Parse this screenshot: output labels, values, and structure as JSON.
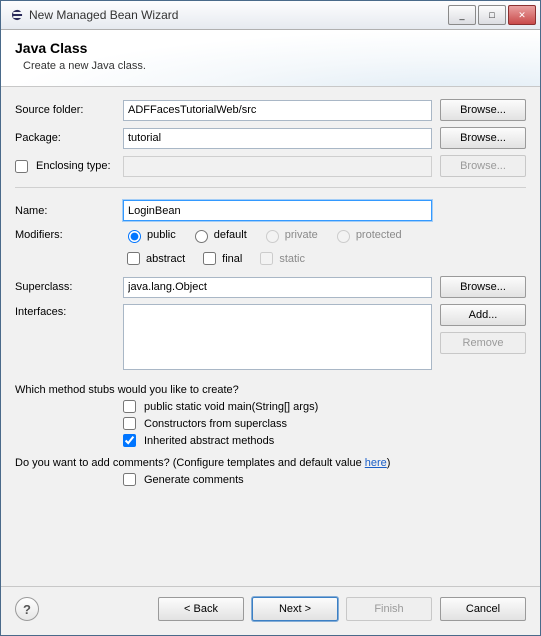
{
  "window": {
    "title": "New Managed Bean Wizard",
    "controls": {
      "minimize": "_",
      "maximize": "□",
      "close": "✕"
    }
  },
  "banner": {
    "heading": "Java Class",
    "subtext": "Create a new Java class."
  },
  "fields": {
    "sourceFolder": {
      "label": "Source folder:",
      "value": "ADFFacesTutorialWeb/src",
      "browse": "Browse..."
    },
    "package": {
      "label": "Package:",
      "value": "tutorial",
      "browse": "Browse..."
    },
    "enclosingType": {
      "label": "Enclosing type:",
      "value": "",
      "browse": "Browse..."
    },
    "name": {
      "label": "Name:",
      "value": "LoginBean"
    },
    "modifiers": {
      "label": "Modifiers:",
      "radios": {
        "public": "public",
        "default": "default",
        "private": "private",
        "protected": "protected"
      },
      "checks": {
        "abstract": "abstract",
        "final": "final",
        "static": "static"
      }
    },
    "superclass": {
      "label": "Superclass:",
      "value": "java.lang.Object",
      "browse": "Browse..."
    },
    "interfaces": {
      "label": "Interfaces:",
      "add": "Add...",
      "remove": "Remove"
    }
  },
  "stubs": {
    "question": "Which method stubs would you like to create?",
    "main": "public static void main(String[] args)",
    "constructors": "Constructors from superclass",
    "inherited": "Inherited abstract methods"
  },
  "comments": {
    "questionPrefix": "Do you want to add comments? (Configure templates and default value ",
    "link": "here",
    "questionSuffix": ")",
    "generate": "Generate comments"
  },
  "footer": {
    "help": "?",
    "back": "< Back",
    "next": "Next >",
    "finish": "Finish",
    "cancel": "Cancel"
  }
}
